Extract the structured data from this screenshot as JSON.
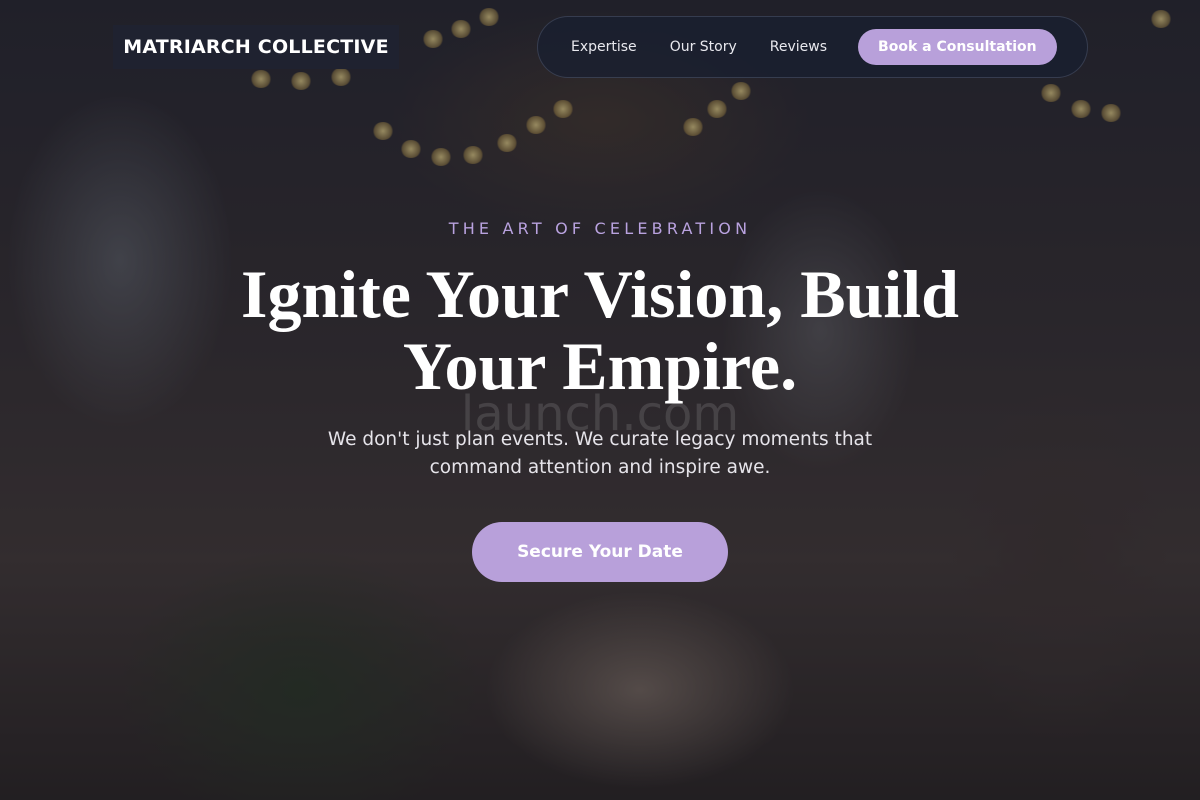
{
  "brand": {
    "name": "MATRIARCH COLLECTIVE"
  },
  "nav": {
    "links": [
      "Expertise",
      "Our Story",
      "Reviews"
    ],
    "cta_label": "Book a Consultation"
  },
  "hero": {
    "eyebrow": "THE ART OF CELEBRATION",
    "headline": "Ignite Your Vision, Build Your Empire.",
    "subtext": "We don't just plan events. We curate legacy moments that command attention and inspire awe.",
    "cta_label": "Secure Your Date",
    "watermark": "launch.com"
  },
  "colors": {
    "accent": "#b8a0da",
    "brand_bg": "#1f2230",
    "nav_bg": "#181e30"
  }
}
